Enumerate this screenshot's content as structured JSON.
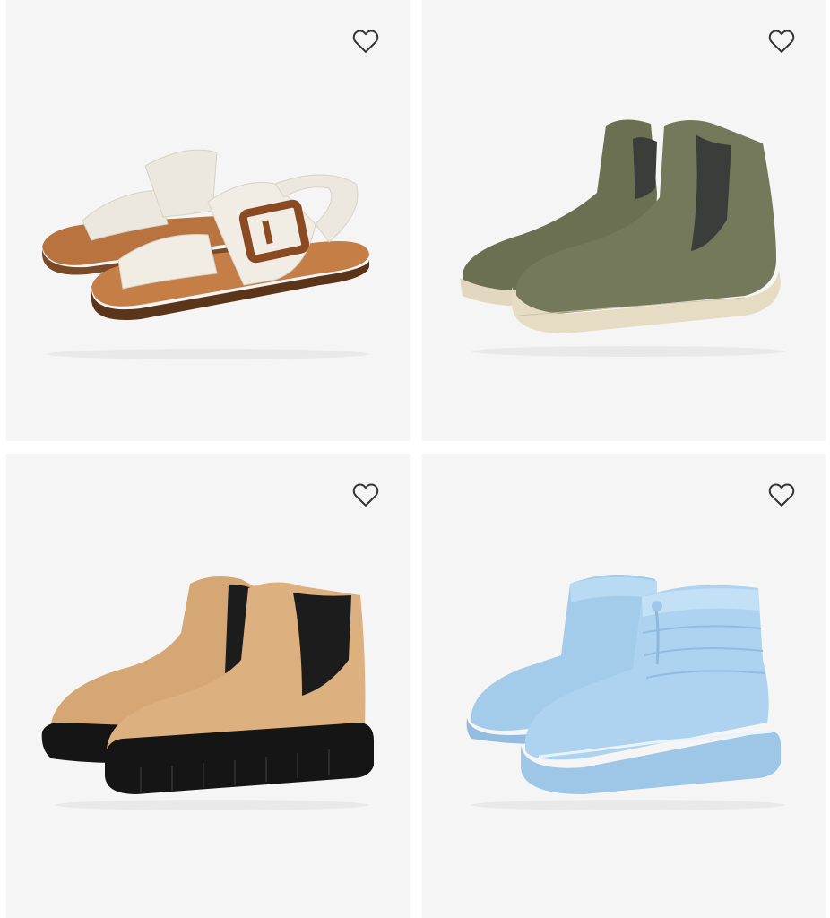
{
  "products": [
    {
      "favorite_icon": "heart-outline-icon",
      "image_subject": "white two-strap buckle sandal",
      "colors": {
        "upper": "#ece8df",
        "sole": "#b8733f",
        "buckle": "#8a4a22"
      }
    },
    {
      "favorite_icon": "heart-outline-icon",
      "image_subject": "olive suede chelsea wedge bootie",
      "colors": {
        "upper": "#6f7556",
        "gore": "#3a3d3a",
        "sole": "#e6dcc4"
      }
    },
    {
      "favorite_icon": "heart-outline-icon",
      "image_subject": "tan leather lug-sole chelsea boot",
      "colors": {
        "upper": "#d9ad7c",
        "gore": "#1c1c1c",
        "sole": "#151515"
      }
    },
    {
      "favorite_icon": "heart-outline-icon",
      "image_subject": "light blue quilted puffer ankle boot",
      "colors": {
        "upper": "#a9d0ee",
        "sole": "#9ec6e6",
        "trim": "#e8f3fb"
      }
    }
  ]
}
